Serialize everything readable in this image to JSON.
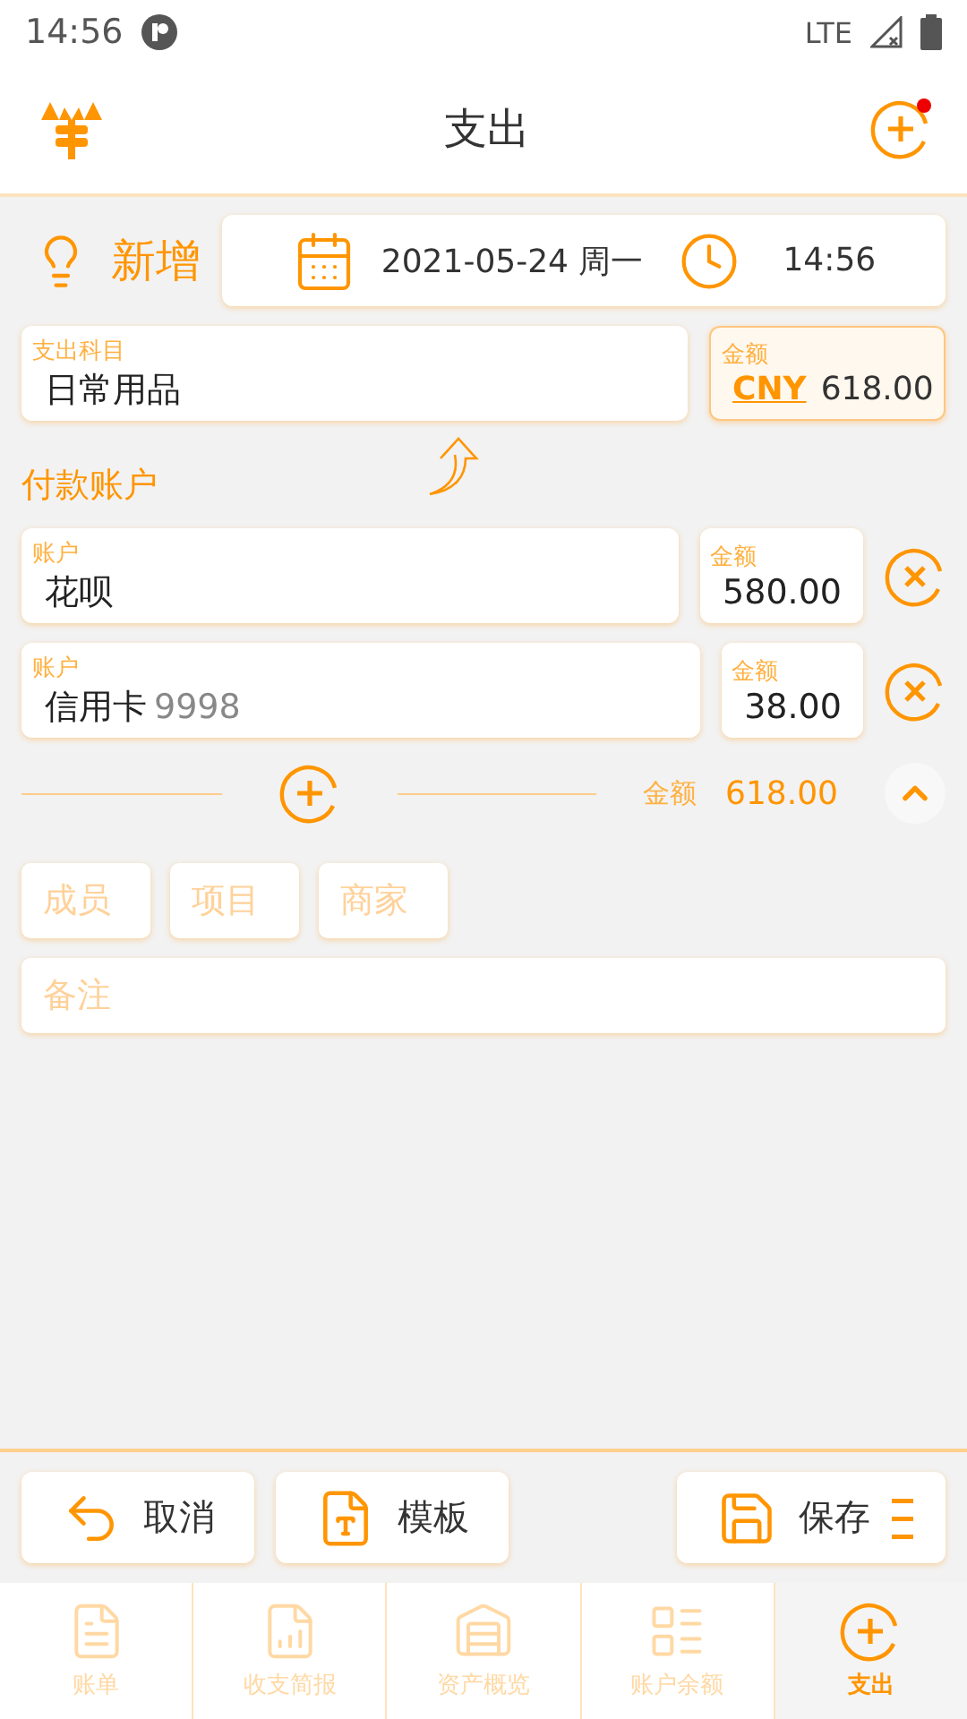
{
  "status_bar": {
    "time": "14:56",
    "network": "LTE"
  },
  "header": {
    "title": "支出",
    "notification": true
  },
  "entry": {
    "mode": "新增",
    "date": "2021-05-24 周一",
    "time": "14:56"
  },
  "category": {
    "label": "支出科目",
    "value": "日常用品"
  },
  "amount": {
    "label": "金额",
    "currency": "CNY",
    "value": "618.00"
  },
  "payment": {
    "title": "付款账户",
    "accounts": [
      {
        "label": "账户",
        "name": "花呗",
        "amount_label": "金额",
        "amount": "580.00"
      },
      {
        "label": "账户",
        "name": "信用卡",
        "suffix": "9998",
        "amount_label": "金额",
        "amount": "38.00"
      }
    ],
    "total_label": "金额",
    "total": "618.00",
    "expanded": true
  },
  "tags": [
    {
      "placeholder": "成员"
    },
    {
      "placeholder": "项目"
    },
    {
      "placeholder": "商家"
    }
  ],
  "note": {
    "placeholder": "备注"
  },
  "actions": [
    {
      "kind": "cancel",
      "label": "取消"
    },
    {
      "kind": "template",
      "label": "模板"
    },
    {
      "kind": "save",
      "label": "保存"
    }
  ],
  "tabs": [
    {
      "label": "账单",
      "selected": false
    },
    {
      "label": "收支简报",
      "selected": false
    },
    {
      "label": "资产概览",
      "selected": false
    },
    {
      "label": "账户余额",
      "selected": false
    },
    {
      "label": "支出",
      "selected": true
    }
  ]
}
